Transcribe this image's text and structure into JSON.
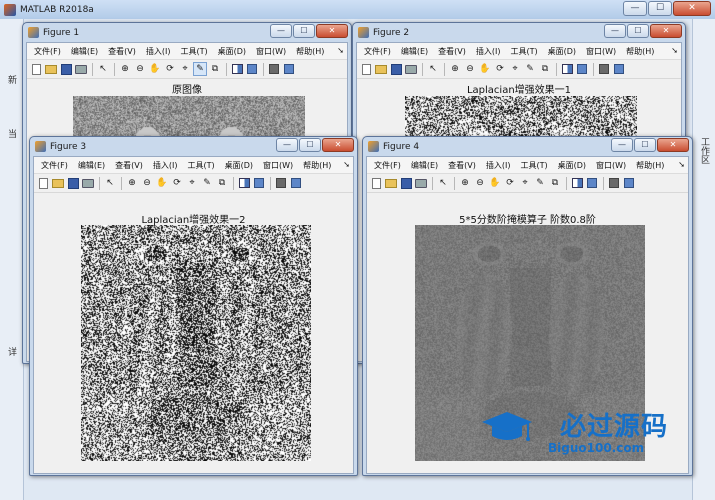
{
  "main_window": {
    "title": "MATLAB R2018a",
    "min_glyph": "—",
    "max_glyph": "☐",
    "close_glyph": "✕"
  },
  "background_scraps": {
    "left_1": "新",
    "left_2": "当",
    "left_3": "详",
    "right_vertical": "工作区"
  },
  "figure_menu": [
    "文件(F)",
    "编辑(E)",
    "查看(V)",
    "插入(I)",
    "工具(T)",
    "桌面(D)",
    "窗口(W)",
    "帮助(H)"
  ],
  "figure_menu_arrow": "➘",
  "figure_buttons": {
    "min": "—",
    "max": "☐",
    "close": "✕"
  },
  "figures": [
    {
      "title": "Figure 1",
      "axes_title": "原图像",
      "filter": "original"
    },
    {
      "title": "Figure 2",
      "axes_title": "Laplacian增强效果一1",
      "filter": "lap1"
    },
    {
      "title": "Figure 3",
      "axes_title": "Laplacian增强效果一2",
      "filter": "lap2"
    },
    {
      "title": "Figure 4",
      "axes_title": "5*5分数阶掩模算子 阶数0.8阶",
      "filter": "frac"
    }
  ],
  "toolbar_icons": [
    "new-file-icon",
    "open-folder-icon",
    "save-icon",
    "print-icon",
    "pointer-icon",
    "zoom-in-icon",
    "zoom-out-icon",
    "pan-icon",
    "rotate-icon",
    "data-cursor-icon",
    "brush-icon",
    "link-icon",
    "colorbar-icon",
    "legend-icon",
    "hide-tools-icon",
    "dock-icon"
  ],
  "watermark": {
    "text_cn": "必过源码",
    "url": "Biguo100.com",
    "color": "#1670c8"
  },
  "colors": {
    "desktop": "#7a94b6",
    "title_bar": "#c9d9ec",
    "figure_bg": "#f0f0f0"
  }
}
